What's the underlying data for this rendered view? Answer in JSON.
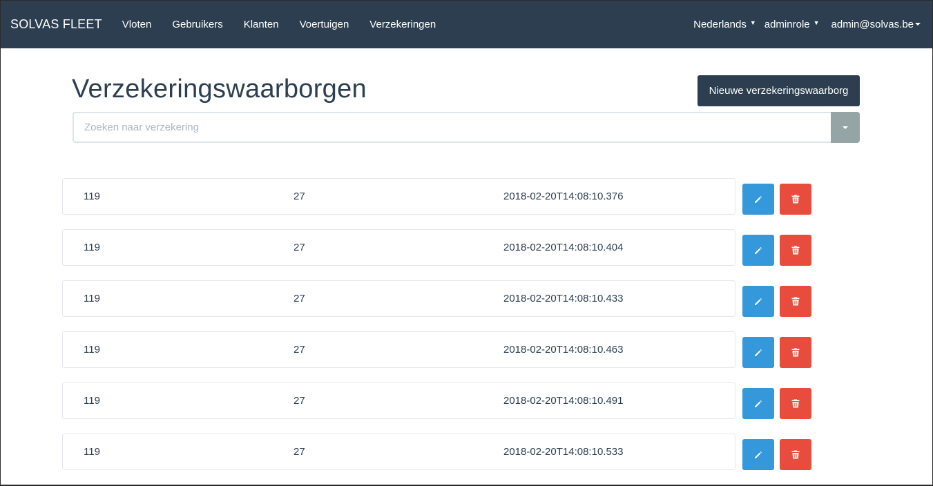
{
  "navbar": {
    "brand": "SOLVAS FLEET",
    "links": [
      {
        "label": "Vloten"
      },
      {
        "label": "Gebruikers"
      },
      {
        "label": "Klanten"
      },
      {
        "label": "Voertuigen"
      },
      {
        "label": "Verzekeringen"
      }
    ],
    "language": "Nederlands",
    "role": "adminrole",
    "user": "admin@solvas.be",
    "background_color": "#2c3e50"
  },
  "page": {
    "title": "Verzekeringswaarborgen",
    "new_button_label": "Nieuwe verzekeringswaarborg"
  },
  "search": {
    "placeholder": "Zoeken naar verzekering",
    "value": ""
  },
  "rows": [
    {
      "col1": "119",
      "col2": "27",
      "col3": "2018-02-20T14:08:10.376"
    },
    {
      "col1": "119",
      "col2": "27",
      "col3": "2018-02-20T14:08:10.404"
    },
    {
      "col1": "119",
      "col2": "27",
      "col3": "2018-02-20T14:08:10.433"
    },
    {
      "col1": "119",
      "col2": "27",
      "col3": "2018-02-20T14:08:10.463"
    },
    {
      "col1": "119",
      "col2": "27",
      "col3": "2018-02-20T14:08:10.491"
    },
    {
      "col1": "119",
      "col2": "27",
      "col3": "2018-02-20T14:08:10.533"
    }
  ],
  "icons": {
    "edit": "pencil-icon",
    "delete": "trash-icon",
    "search_toggle": "caret-down-icon"
  },
  "colors": {
    "primary": "#2c3e50",
    "edit_button": "#3498db",
    "delete_button": "#e74c3c",
    "search_toggle": "#95a5a6"
  }
}
